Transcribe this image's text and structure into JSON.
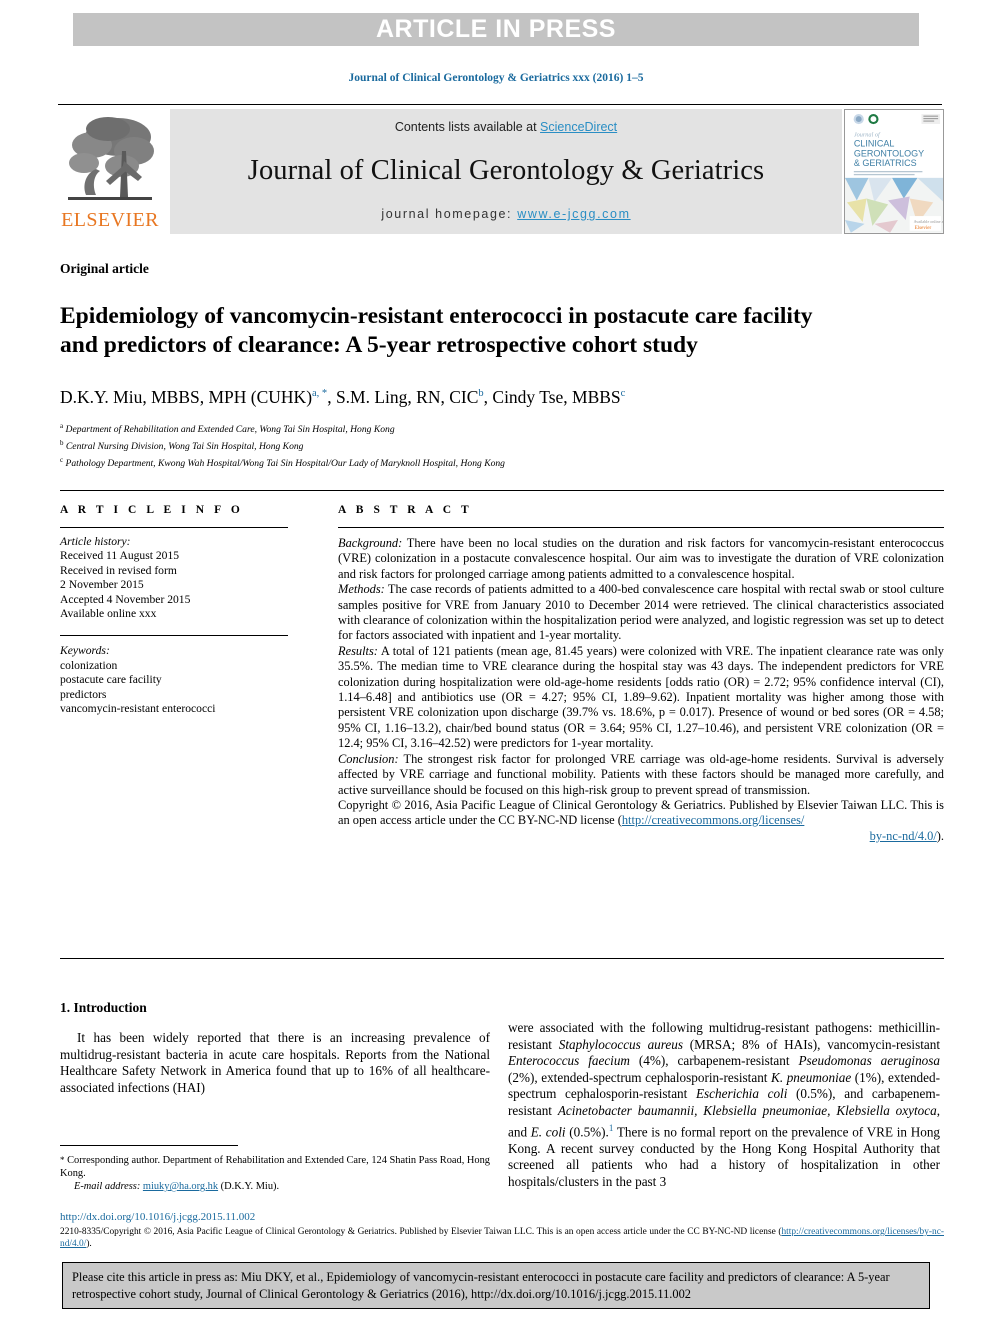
{
  "banner": {
    "text": "ARTICLE IN PRESS"
  },
  "citation_line": "Journal of Clinical Gerontology & Geriatrics xxx (2016) 1–5",
  "masthead": {
    "contents_prefix": "Contents lists available at ",
    "contents_link": "ScienceDirect",
    "journal_title": "Journal of Clinical Gerontology & Geriatrics",
    "homepage_prefix": "journal homepage: ",
    "homepage_url": "www.e-jcgg.com",
    "publisher_logo_text": "ELSEVIER",
    "cover": {
      "line1": "Journal of",
      "line2": "CLINICAL",
      "line3": "GERONTOLOGY",
      "line4": "& GERIATRICS",
      "tagline": "Official Journal of the Asia Pacific League of Clinical Gerontology & Geriatrics",
      "corner_note": "ISSN 2210-8335",
      "footer_mark": "ELSEVIER"
    }
  },
  "article_type": "Original article",
  "title": "Epidemiology of vancomycin-resistant enterococci in postacute care facility and predictors of clearance: A 5-year retrospective cohort study",
  "authors": {
    "a1_name": "D.K.Y. Miu, MBBS, MPH (CUHK)",
    "a1_sup": "a, *",
    "a2_name": "S.M. Ling, RN, CIC",
    "a2_sup": "b",
    "a3_name": "Cindy Tse, MBBS",
    "a3_sup": "c",
    "affiliations": [
      {
        "marker": "a",
        "text": "Department of Rehabilitation and Extended Care, Wong Tai Sin Hospital, Hong Kong"
      },
      {
        "marker": "b",
        "text": "Central Nursing Division, Wong Tai Sin Hospital, Hong Kong"
      },
      {
        "marker": "c",
        "text": "Pathology Department, Kwong Wah Hospital/Wong Tai Sin Hospital/Our Lady of Maryknoll Hospital, Hong Kong"
      }
    ]
  },
  "article_info": {
    "heading": "A R T I C L E   I N F O",
    "history_label": "Article history:",
    "history": [
      "Received 11 August 2015",
      "Received in revised form",
      "2 November 2015",
      "Accepted 4 November 2015",
      "Available online xxx"
    ],
    "keywords_label": "Keywords:",
    "keywords": [
      "colonization",
      "postacute care facility",
      "predictors",
      "vancomycin-resistant enterococci"
    ]
  },
  "abstract": {
    "heading": "A B S T R A C T",
    "background_label": "Background:",
    "background": " There have been no local studies on the duration and risk factors for vancomycin-resistant enterococcus (VRE) colonization in a postacute convalescence hospital. Our aim was to investigate the duration of VRE colonization and risk factors for prolonged carriage among patients admitted to a convalescence hospital.",
    "methods_label": "Methods:",
    "methods": " The case records of patients admitted to a 400-bed convalescence care hospital with rectal swab or stool culture samples positive for VRE from January 2010 to December 2014 were retrieved. The clinical characteristics associated with clearance of colonization within the hospitalization period were analyzed, and logistic regression was set up to detect for factors associated with inpatient and 1-year mortality.",
    "results_label": "Results:",
    "results": " A total of 121 patients (mean age, 81.45 years) were colonized with VRE. The inpatient clearance rate was only 35.5%. The median time to VRE clearance during the hospital stay was 43 days. The independent predictors for VRE colonization during hospitalization were old-age-home residents [odds ratio (OR) = 2.72; 95% confidence interval (CI), 1.14–6.48] and antibiotics use (OR = 4.27; 95% CI, 1.89–9.62). Inpatient mortality was higher among those with persistent VRE colonization upon discharge (39.7% vs. 18.6%, p = 0.017). Presence of wound or bed sores (OR = 4.58; 95% CI, 1.16–13.2), chair/bed bound status (OR = 3.64; 95% CI, 1.27–10.46), and persistent VRE colonization (OR = 12.4; 95% CI, 3.16–42.52) were predictors for 1-year mortality.",
    "conclusion_label": "Conclusion:",
    "conclusion": " The strongest risk factor for prolonged VRE carriage was old-age-home residents. Survival is adversely affected by VRE carriage and functional mobility. Patients with these factors should be managed more carefully, and active surveillance should be focused on this high-risk group to prevent spread of transmission.",
    "copyright_text": "Copyright © 2016, Asia Pacific League of Clinical Gerontology & Geriatrics. Published by Elsevier Taiwan LLC. This is an open access article under the CC BY-NC-ND license (",
    "copyright_link": "http://creativecommons.org/licenses/",
    "copyright_link_tail": "by-nc-nd/4.0/",
    "copyright_close": ")."
  },
  "introduction": {
    "heading": "1.  Introduction",
    "left_para_1": "It has been widely reported that there is an increasing prevalence of multidrug-resistant bacteria in acute care hospitals. Reports from the National Healthcare Safety Network in America found that up to 16% of all healthcare-associated infections (HAI)",
    "right_lead": "were associated with the following multidrug-resistant pathogens:",
    "right_seg_1": "methicillin-resistant ",
    "right_ital_1": "Staphylococcus aureus",
    "right_seg_2": " (MRSA; 8% of HAIs), vancomycin-resistant ",
    "right_ital_2": "Enterococcus faecium",
    "right_seg_3": " (4%), carbapenem-resistant ",
    "right_ital_3": "Pseudomonas aeruginosa",
    "right_seg_4": " (2%), extended-spectrum cephalosporin-resistant ",
    "right_ital_4": "K. pneumoniae",
    "right_seg_5": " (1%), extended-spectrum cephalosporin-resistant ",
    "right_ital_5": "Escherichia coli",
    "right_seg_6": " (0.5%), and carbapenem-resistant ",
    "right_ital_6": "Acinetobacter baumannii, Klebsiella pneumoniae, Klebsiella oxytoca",
    "right_seg_7": ", and ",
    "right_ital_7": "E. coli",
    "right_seg_8": " (0.5%).",
    "right_ref": "1",
    "right_seg_9": " There is no formal report on the prevalence of VRE in Hong Kong. A recent survey conducted by the Hong Kong Hospital Authority that screened all patients who had a history of hospitalization in other hospitals/clusters in the past 3"
  },
  "footnote": {
    "star": "*",
    "corresponding": " Corresponding author. Department of Rehabilitation and Extended Care, 124 Shatin Pass Road, Hong Kong.",
    "email_label": "E-mail address:",
    "email": "miuky@ha.org.hk",
    "email_owner": " (D.K.Y. Miu)."
  },
  "footer": {
    "doi": "http://dx.doi.org/10.1016/j.jcgg.2015.11.002",
    "issn_text": "2210-8335/Copyright © 2016, Asia Pacific League of Clinical Gerontology & Geriatrics. Published by Elsevier Taiwan LLC. This is an open access article under the CC BY-NC-ND license (",
    "issn_link": "http://creativecommons.org/licenses/by-nc-nd/4.0/",
    "issn_close": ")."
  },
  "cite_box": {
    "text": "Please cite this article in press as: Miu DKY, et al., Epidemiology of vancomycin-resistant enterococci in postacute care facility and predictors of clearance: A 5-year retrospective cohort study, Journal of Clinical Gerontology & Geriatrics (2016), http://dx.doi.org/10.1016/j.jcgg.2015.11.002"
  },
  "colors": {
    "banner_grey": "#c3c3c3",
    "masthead_grey": "#e3e3e3",
    "link_blue": "#1a6a9e",
    "sciencedirect_blue": "#2a8ec4",
    "elsevier_orange": "#e87722",
    "cite_box_grey": "#c9c9c9"
  }
}
